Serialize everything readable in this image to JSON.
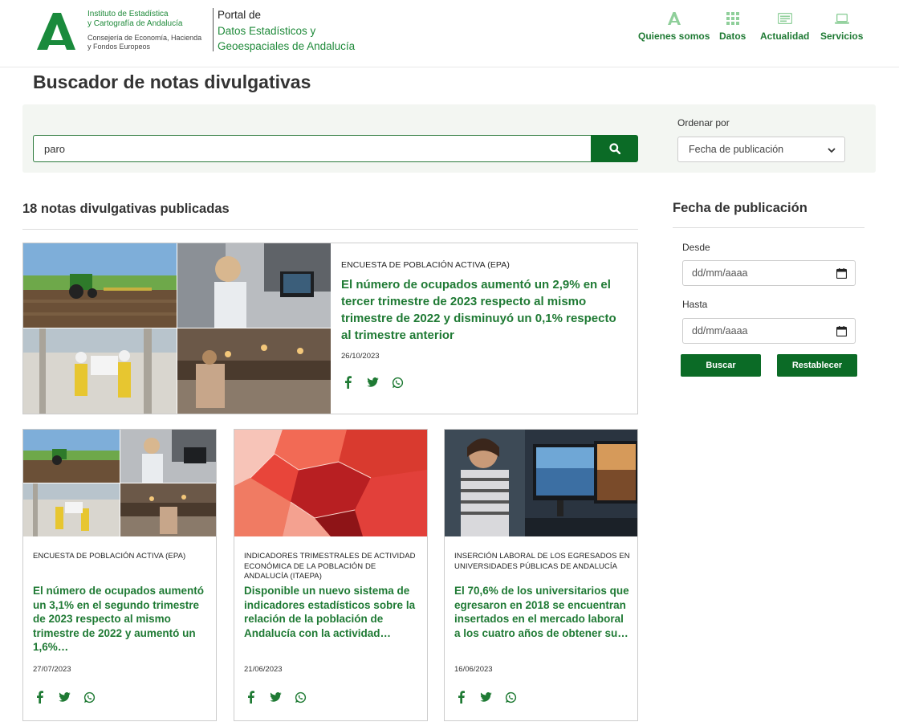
{
  "header": {
    "institute_line1": "Instituto de Estadística",
    "institute_line2": "y Cartografía de Andalucía",
    "consejeria_line1": "Consejería de Economía, Hacienda",
    "consejeria_line2": "y Fondos Europeos",
    "portal_line1": "Portal de",
    "portal_line2": "Datos Estadísticos y",
    "portal_line3": "Geoespaciales de Andalucía",
    "nav": [
      {
        "label": "Quienes somos",
        "icon": "a-logo-icon"
      },
      {
        "label": "Datos",
        "icon": "grid-icon"
      },
      {
        "label": "Actualidad",
        "icon": "news-icon"
      },
      {
        "label": "Servicios",
        "icon": "laptop-icon"
      }
    ]
  },
  "page_title": "Buscador de notas divulgativas",
  "search": {
    "value": "paro",
    "placeholder": "",
    "sort_label": "Ordenar por",
    "sort_selected": "Fecha de publicación"
  },
  "results_count": "18 notas divulgativas publicadas",
  "featured": {
    "category": "ENCUESTA DE POBLACIÓN ACTIVA (EPA)",
    "title": "El número de ocupados aumentó un 2,9% en el tercer trimestre de 2023 respecto al mismo trimestre de 2022 y disminuyó un 0,1% respecto al trimestre anterior",
    "date": "26/10/2023"
  },
  "cards": [
    {
      "category": "ENCUESTA DE POBLACIÓN ACTIVA (EPA)",
      "title": "El número de ocupados aumentó un 3,1% en el segundo trimestre de 2023 respecto al mismo trimestre de 2022 y aumentó un 1,6%…",
      "date": "27/07/2023"
    },
    {
      "category": "INDICADORES TRIMESTRALES DE ACTIVIDAD ECONÓMICA DE LA POBLACIÓN DE ANDALUCÍA (ITAEPA)",
      "title": "Disponible un nuevo sistema de indicadores estadísticos sobre la relación de la población de Andalucía con la actividad…",
      "date": "21/06/2023"
    },
    {
      "category": "INSERCIÓN LABORAL DE LOS EGRESADOS EN UNIVERSIDADES PÚBLICAS DE ANDALUCÍA",
      "title": "El 70,6% de los universitarios que egresaron en 2018 se encuentran insertados en el mercado laboral a los cuatro años de obtener su…",
      "date": "16/06/2023"
    }
  ],
  "filter": {
    "title": "Fecha de publicación",
    "from_label": "Desde",
    "from_placeholder": "dd/mm/aaaa",
    "to_label": "Hasta",
    "to_placeholder": "dd/mm/aaaa",
    "search_button": "Buscar",
    "reset_button": "Restablecer"
  },
  "colors": {
    "brand_green": "#0b6b26",
    "title_green": "#1f7a34",
    "panel_bg": "#f3f6f2"
  }
}
